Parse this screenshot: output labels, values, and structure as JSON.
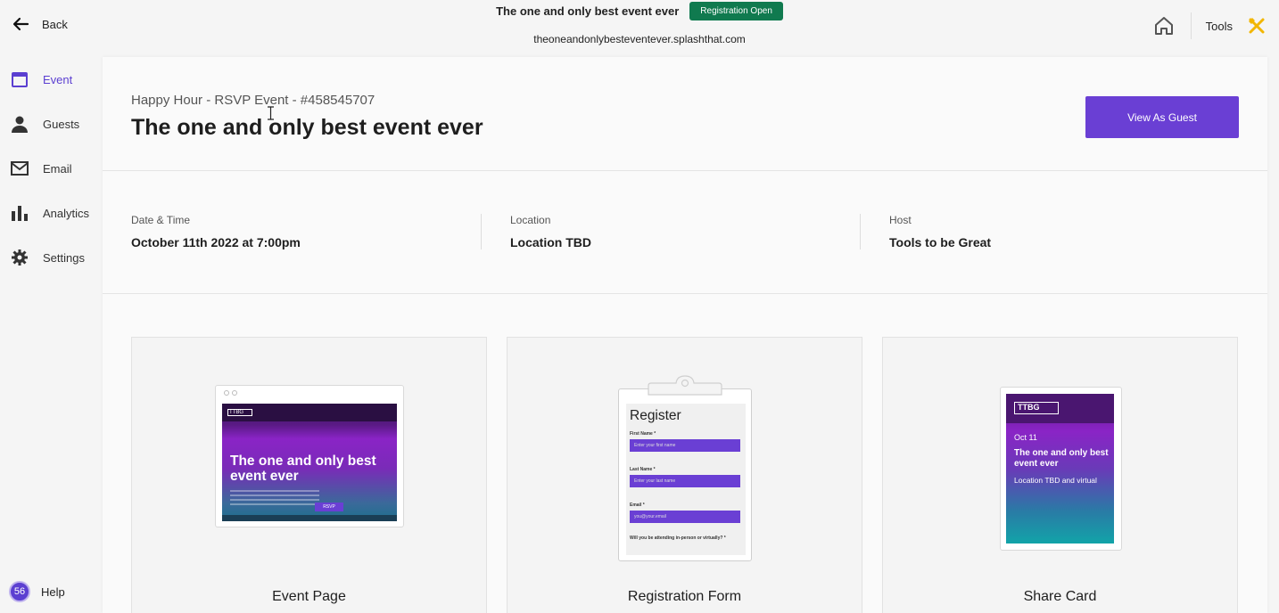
{
  "topbar": {
    "back_label": "Back",
    "event_name": "The one and only best event ever",
    "status_badge": "Registration Open",
    "url": "theoneandonlybesteventever.splashthat.com",
    "tools_label": "Tools"
  },
  "sidebar": {
    "items": [
      {
        "label": "Event",
        "icon": "calendar-icon"
      },
      {
        "label": "Guests",
        "icon": "person-icon"
      },
      {
        "label": "Email",
        "icon": "envelope-icon"
      },
      {
        "label": "Analytics",
        "icon": "bar-chart-icon"
      },
      {
        "label": "Settings",
        "icon": "gear-icon"
      }
    ],
    "active_item": "Event",
    "help_count": "56",
    "help_label": "Help"
  },
  "header": {
    "subtitle": "Happy Hour - RSVP Event - #458545707",
    "title": "The one and only best event ever",
    "view_button": "View As Guest"
  },
  "info": [
    {
      "label": "Date & Time",
      "value": "October 11th 2022 at 7:00pm"
    },
    {
      "label": "Location",
      "value": "Location TBD"
    },
    {
      "label": "Host",
      "value": "Tools to be Great"
    }
  ],
  "cards": [
    {
      "label": "Event Page"
    },
    {
      "label": "Registration Form"
    },
    {
      "label": "Share Card"
    }
  ],
  "event_page_thumb": {
    "logo": "TTBG",
    "headline": "The one and only best event ever",
    "rsvp": "RSVP"
  },
  "registration_thumb": {
    "heading": "Register",
    "fields": [
      {
        "label": "First Name *",
        "placeholder": "Enter your first name"
      },
      {
        "label": "Last Name *",
        "placeholder": "Enter your last name"
      },
      {
        "label": "Email *",
        "placeholder": "you@your.email"
      }
    ],
    "question": "Will you be attending in-person or virtually? *"
  },
  "share_card_thumb": {
    "logo": "TTBG",
    "date": "Oct 11",
    "title": "The one and only best event ever",
    "location": "Location TBD and virtual"
  },
  "colors": {
    "accent": "#6a3fd4",
    "status_green": "#107a4f",
    "tools_yellow": "#f2b600"
  }
}
